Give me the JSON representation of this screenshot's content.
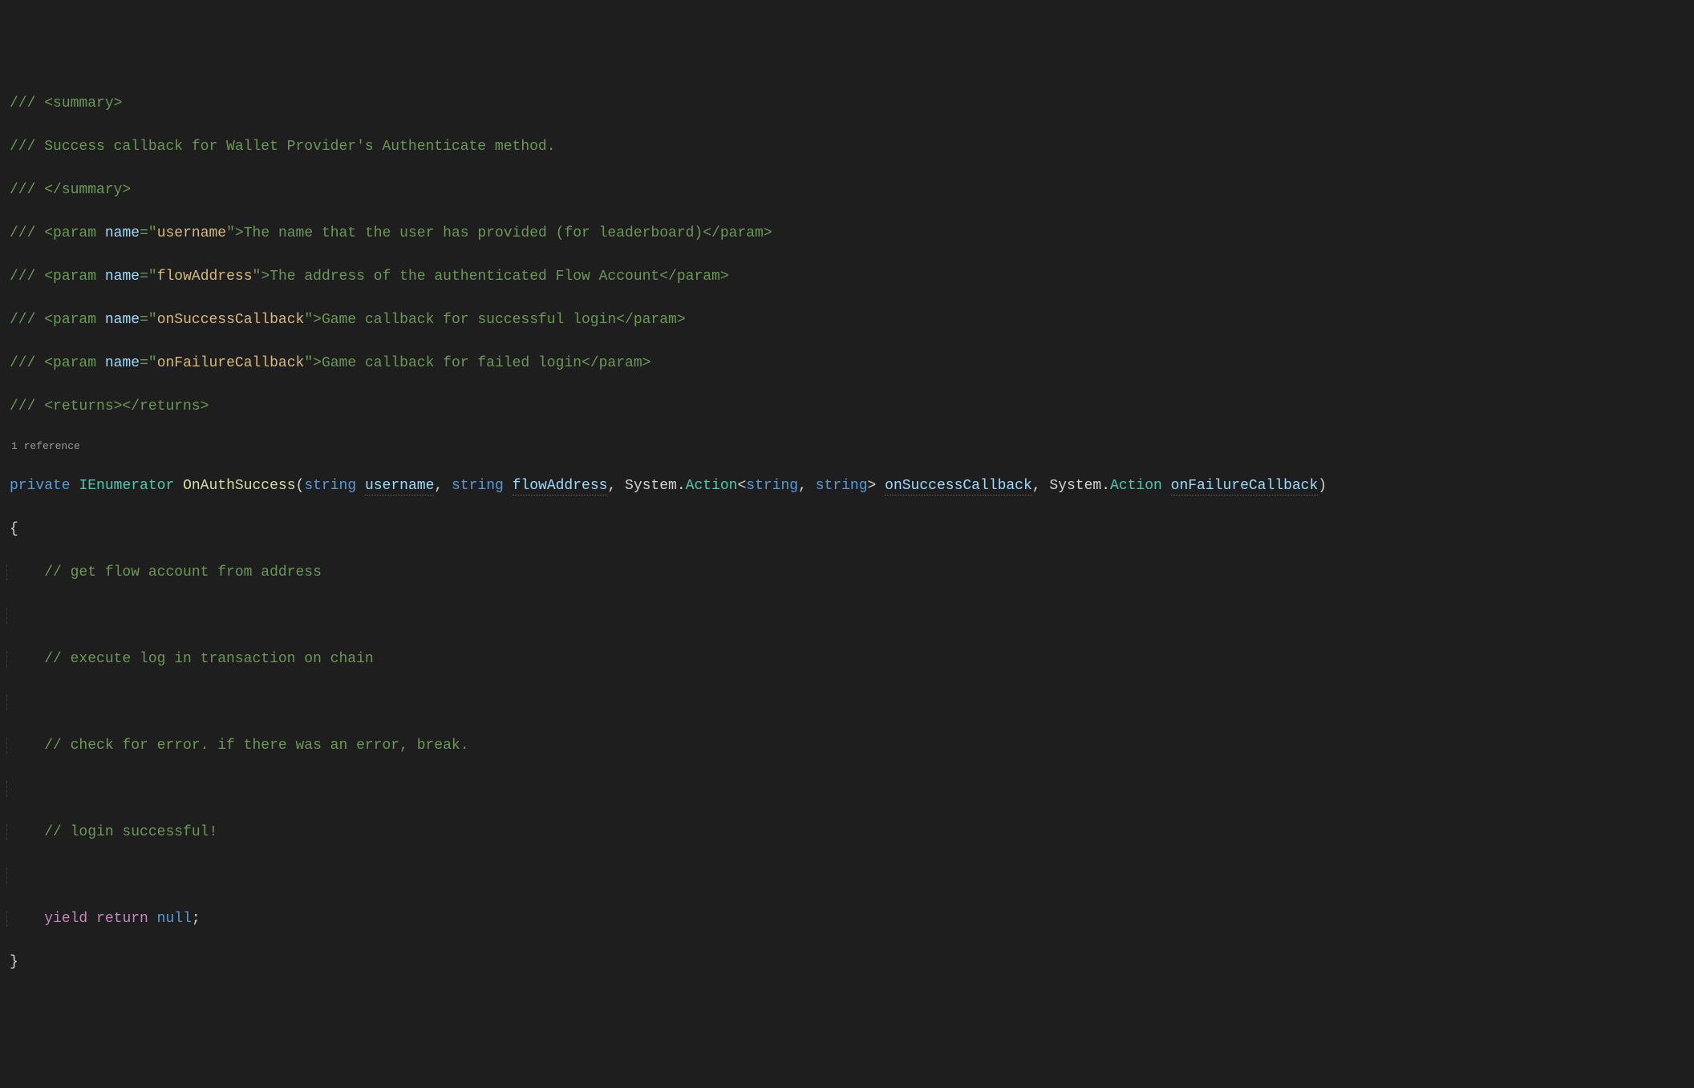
{
  "doc": {
    "summaryOpen": "<summary>",
    "summaryText": "Success callback for Wallet Provider's Authenticate method.",
    "summaryClose": "</summary>",
    "param1Name": "username",
    "param1Desc": "The name that the user has provided (for leaderboard)",
    "param2Name": "flowAddress",
    "param2Desc": "The address of the authenticated Flow Account",
    "param3Name": "onSuccessCallback",
    "param3Desc": "Game callback for successful login",
    "param4Name": "onFailureCallback",
    "param4Desc": "Game callback for failed login",
    "returnsTag": "<returns></returns>",
    "slashes": "/// ",
    "paramOpen": "<param ",
    "nameAttr": "name",
    "eq": "=",
    "qOpen": "\"",
    "qClose": "\"",
    "tagClose": ">",
    "paramEnd": "</param>"
  },
  "codelens": {
    "refs": "1 reference"
  },
  "sig": {
    "accessMod": "private",
    "returnType": "IEnumerator",
    "methodName": "OnAuthSuccess",
    "lparen": "(",
    "p1Type": "string",
    "p1Name": "username",
    "p2Type": "string",
    "p2Name": "flowAddress",
    "p3Ns": "System",
    "p3Dot": ".",
    "p3Type": "Action",
    "p3Lt": "<",
    "p3G1": "string",
    "p3G2": "string",
    "p3Gt": ">",
    "p3Name": "onSuccessCallback",
    "p4Ns": "System",
    "p4Dot": ".",
    "p4Type": "Action",
    "p4Name": "onFailureCallback",
    "rparen": ")",
    "comma": ", "
  },
  "body": {
    "openBrace": "{",
    "closeBrace": "}",
    "c1": "// get flow account from address",
    "c2": "// execute log in transaction on chain",
    "c3": "// check for error. if there was an error, break.",
    "c4": "// login successful!",
    "yield": "yield",
    "return": "return",
    "null": "null",
    "semi": ";"
  }
}
